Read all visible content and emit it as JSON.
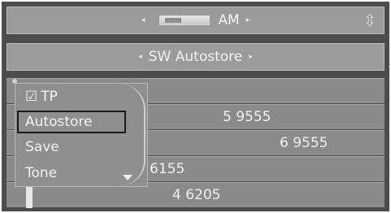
{
  "header": {
    "band_label": "AM",
    "left_arrow": "◂",
    "right_arrow": "▸",
    "nav_icon": "⇳"
  },
  "subheader": {
    "title": "SW Autostore",
    "left_arrow": "◂",
    "right_arrow": "▸"
  },
  "station_rows": [
    {
      "freq": "5 9555"
    },
    {
      "freq": "6 9555"
    },
    {
      "freq": "6155"
    },
    {
      "freq": "4 6205"
    }
  ],
  "menu": {
    "items": [
      {
        "label": "TP",
        "checked": true
      },
      {
        "label": "Autostore",
        "selected": true
      },
      {
        "label": "Save"
      },
      {
        "label": "Tone"
      }
    ],
    "check_glyph": "☑"
  }
}
